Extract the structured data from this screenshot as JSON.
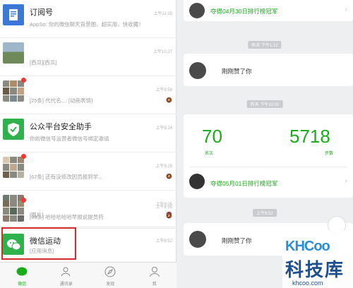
{
  "chat_list": [
    {
      "name": "订阅号",
      "time": "上午11:15",
      "message": "AppSo: 你的微信聊天背景图，超实用，快收藏！",
      "avatar": "subscription-icon",
      "muted": false
    },
    {
      "name": "",
      "time": "上午10:27",
      "message": "[西瓜][西瓜]",
      "avatar": "landscape",
      "muted": false
    },
    {
      "name": "",
      "time": "上午9:58",
      "message": "[25条] 代代名...: [动画表情]",
      "avatar": "group",
      "muted": true
    },
    {
      "name": "公众平台安全助手",
      "time": "上午9:24",
      "message": "你的微信号运营者微信号绑定邀请",
      "avatar": "shield-icon",
      "muted": false
    },
    {
      "name": "",
      "time": "上午9:15",
      "message": "[67条] 还有没修改因员报到学...",
      "avatar": "group",
      "muted": true
    },
    {
      "name": "",
      "time": "上午9:05",
      "message": "[图片]",
      "avatar": "group",
      "muted": true
    },
    {
      "name": "",
      "time": "上午8:55",
      "message": "[99条] 哈哈哈哈哈早报说提员药",
      "avatar": "group",
      "muted": true
    },
    {
      "name": "微信运动",
      "time": "上午8:52",
      "message": "[应用消息]",
      "avatar": "werun-icon",
      "muted": false
    }
  ],
  "tabs": [
    {
      "label": "微信",
      "icon": "chat-icon",
      "active": true
    },
    {
      "label": "通讯录",
      "icon": "contacts-icon",
      "active": false
    },
    {
      "label": "发现",
      "icon": "discover-icon",
      "active": false
    },
    {
      "label": "我",
      "icon": "me-icon",
      "active": false
    }
  ],
  "feed": {
    "champion_top": "夺得04月30日排行榜冠军",
    "stamp_1": "昨天 下午1:12",
    "like_1": "刚刚赞了你",
    "stamp_2": "昨天 下午10:00",
    "rank_value": "70",
    "rank_label": "名次",
    "steps_value": "5718",
    "steps_label": "步数",
    "champion_bottom": "夺得05月01日排行榜冠军",
    "stamp_3": "上午8:52",
    "like_2": "刚刚赞了你"
  },
  "watermark": {
    "logo": "KHCoo",
    "cn": "科技库",
    "url": "khcoo.com"
  },
  "colors": {
    "accent": "#1aad19",
    "highlight": "#d62b2b"
  }
}
